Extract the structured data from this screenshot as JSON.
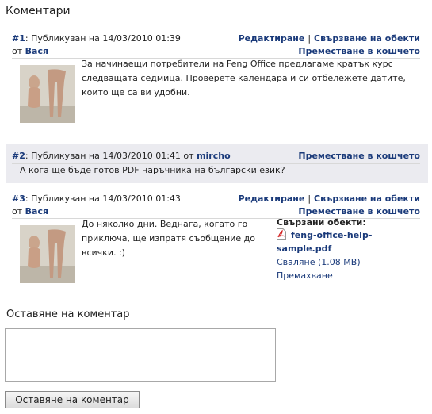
{
  "section_title": "Коментари",
  "comments": [
    {
      "num": "#1",
      "posted": ": Публикуван на 14/03/2010 01:39",
      "by_prefix": "от",
      "author": "Вася",
      "actions": [
        "Редактиране",
        "Свързване на обекти"
      ],
      "trash": "Преместване в кошчето",
      "text": "За начинаещи потребители на Feng Office предлагаме кратък курс следващата седмица. Проверете календара и си отбележете датите, които ще са ви удобни."
    },
    {
      "num": "#2",
      "posted": ": Публикуван на 14/03/2010 01:41 от",
      "author": "mircho",
      "trash": "Преместване в кошчето",
      "text": "А кога ще бъде готов PDF наръчника на български език?"
    },
    {
      "num": "#3",
      "posted": ": Публикуван на 14/03/2010 01:43",
      "by_prefix": "от",
      "author": "Вася",
      "actions": [
        "Редактиране",
        "Свързване на обекти"
      ],
      "trash": "Преместване в кошчето",
      "text": "До няколко дни. Веднага, когато го приключа, ще изпратя съобщение до всички. :)",
      "attachments_title": "Свързани обекти:",
      "attachment": {
        "name": "feng-office-help-sample.pdf",
        "download": "Сваляне (1.08 MB)",
        "remove": "Премахване"
      }
    }
  ],
  "form": {
    "title": "Оставяне на коментар",
    "submit": "Оставяне на коментар"
  }
}
